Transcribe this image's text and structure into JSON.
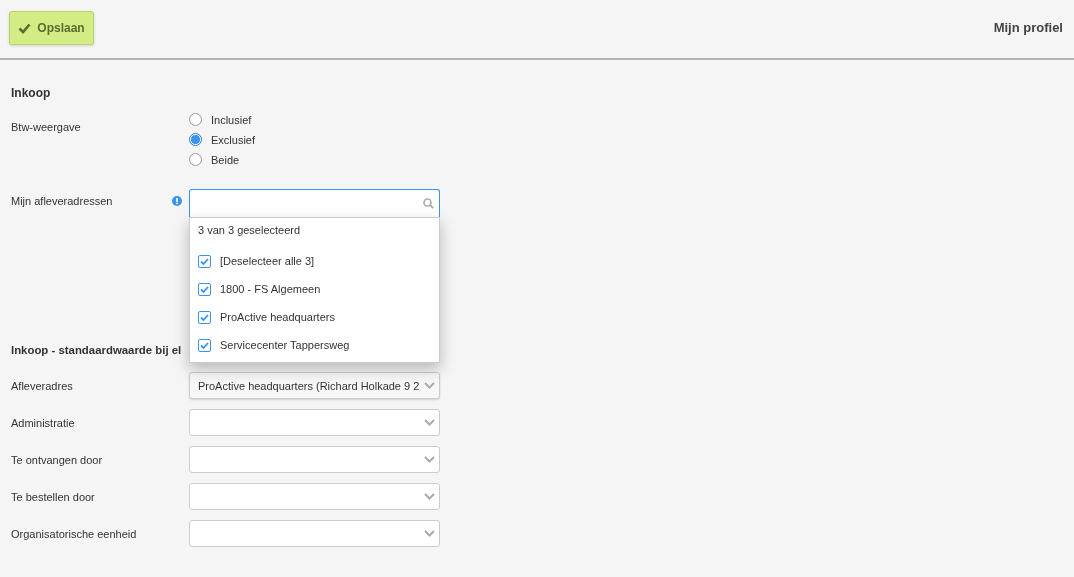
{
  "header": {
    "save_button": "Opslaan",
    "title": "Mijn profiel"
  },
  "purchase": {
    "title": "Inkoop",
    "vat": {
      "label": "Btw-weergave",
      "options": [
        {
          "label": "Inclusief",
          "selected": false
        },
        {
          "label": "Exclusief",
          "selected": true
        },
        {
          "label": "Beide",
          "selected": false
        }
      ]
    },
    "addresses": {
      "label": "Mijn afleveradressen",
      "expanded": true,
      "summary": "3 van 3 geselecteerd",
      "items": [
        {
          "label": "[Deselecteer alle 3]",
          "checked": true
        },
        {
          "label": "1800 - FS Algemeen",
          "checked": true
        },
        {
          "label": "ProActive headquarters",
          "checked": true
        },
        {
          "label": "Servicecenter Tappersweg",
          "checked": true
        }
      ]
    }
  },
  "defaults": {
    "title": "Inkoop - standaardwaarde bij el",
    "fields": [
      {
        "label": "Afleveradres",
        "value": "ProActive headquarters (Richard Holkade 9 2"
      },
      {
        "label": "Administratie"
      },
      {
        "label": "Te ontvangen door"
      },
      {
        "label": "Te bestellen door"
      },
      {
        "label": "Organisatorische eenheid"
      }
    ]
  }
}
